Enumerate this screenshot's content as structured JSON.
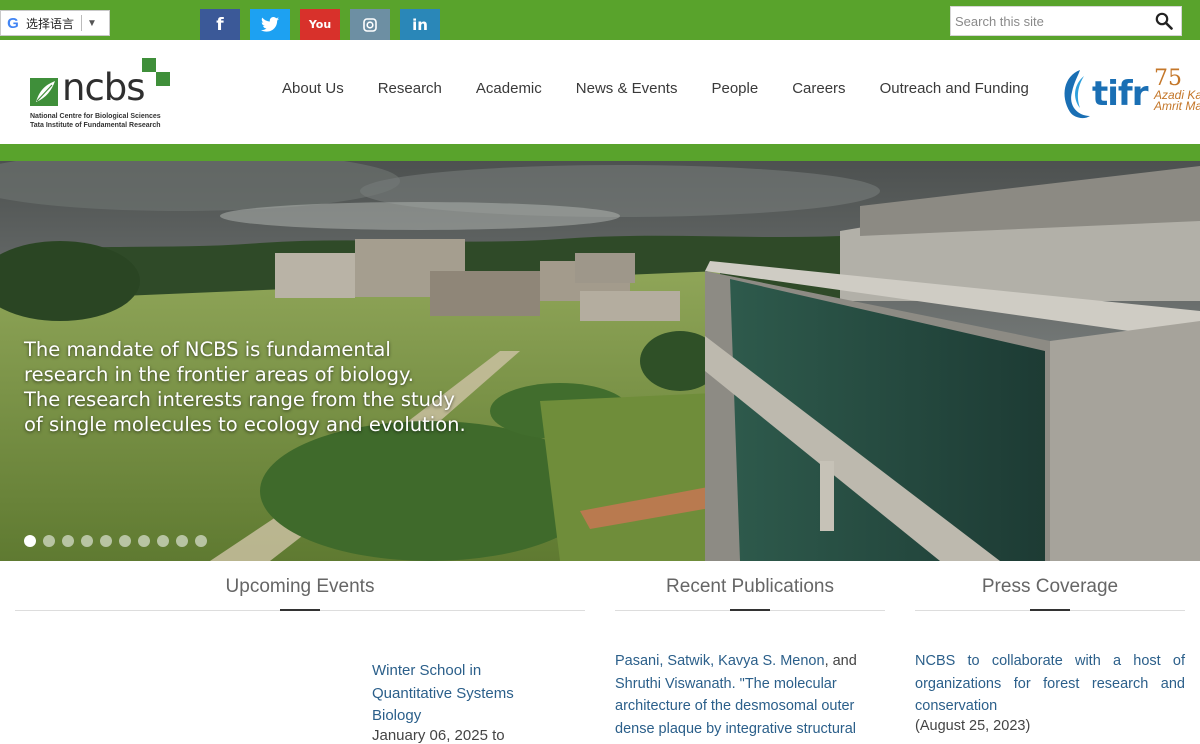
{
  "topbar": {
    "translate_label": "选择语言",
    "translate_arrow": "▼",
    "social": {
      "facebook": "f",
      "twitter": "🐦",
      "youtube": "You",
      "instagram": "◙",
      "linkedin": "in"
    },
    "search_placeholder": "Search this site",
    "search_icon": "search-icon"
  },
  "logo": {
    "word": "ncbs",
    "line1": "National Centre for Biological Sciences",
    "line2": "Tata Institute of Fundamental Research"
  },
  "nav": {
    "items": [
      "About Us",
      "Research",
      "Academic",
      "News & Events",
      "People",
      "Careers",
      "Outreach and Funding"
    ]
  },
  "partner": {
    "tifr": "tifr",
    "seventy": "75",
    "azadi_line1": "Azadi Ka",
    "azadi_line2": "Amrit Mah"
  },
  "hero": {
    "lines": [
      "The mandate of NCBS is fundamental",
      "research in the frontier areas of biology.",
      "The research interests range from the study",
      "of single molecules to ecology and evolution."
    ],
    "slide_count": 10,
    "active_slide": 1
  },
  "sections": {
    "events_title": "Upcoming Events",
    "publications_title": "Recent Publications",
    "press_title": "Press Coverage"
  },
  "events": {
    "title": "Winter School in Quantitative Systems Biology",
    "date": "January 06, 2025 to"
  },
  "publications": {
    "authors": "Pasani, Satwik, Kavya S. Menon",
    "authors_tail": ", and",
    "text": "Shruthi Viswanath. \"The molecular architecture of the desmosomal outer dense plaque by integrative structural"
  },
  "press": {
    "headline": "NCBS to collaborate with a host of organizations for forest research and conservation",
    "date": "(August 25, 2023)"
  },
  "colors": {
    "brand_green": "#59a32c",
    "link_blue": "#2b5f8a"
  }
}
